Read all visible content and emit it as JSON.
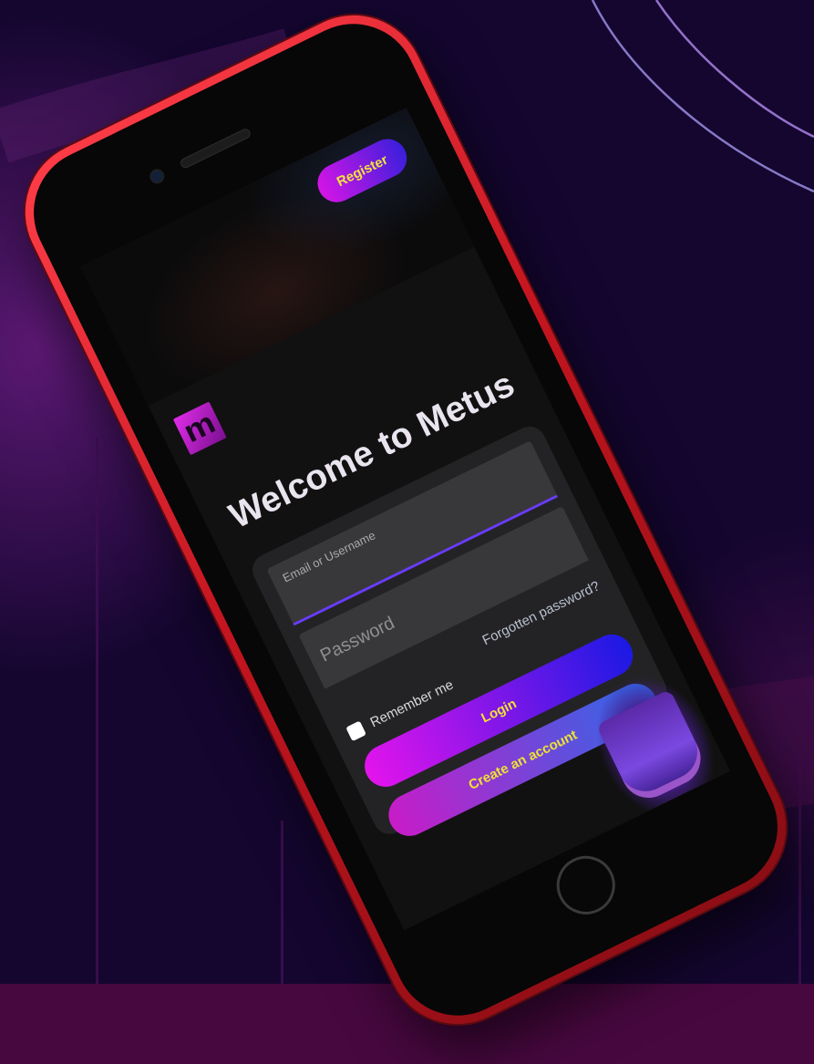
{
  "header": {
    "register_label": "Register"
  },
  "brand": {
    "logo_letter": "m"
  },
  "main": {
    "title": "Welcome to Metus"
  },
  "login_form": {
    "username_label": "Email or Username",
    "password_label": "Password",
    "forgot_password_label": "Forgotten password?",
    "remember_label": "Remember me",
    "remember_checked": false,
    "login_label": "Login",
    "create_account_label": "Create an account"
  },
  "colors": {
    "phone_frame": "#e3262f",
    "accent_magenta": "#e414ec",
    "accent_blue": "#1b19e4",
    "button_text": "#efe233",
    "field_underline": "#6a3bff"
  }
}
